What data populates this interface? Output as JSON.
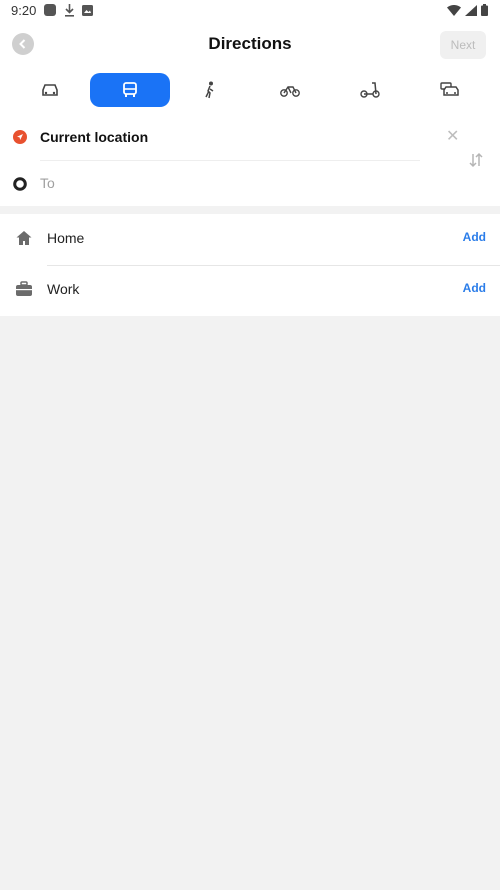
{
  "status_bar": {
    "time": "9:20"
  },
  "header": {
    "title": "Directions",
    "next_label": "Next"
  },
  "transport_modes": [
    "car",
    "transit",
    "walk",
    "bike",
    "scooter",
    "taxi"
  ],
  "active_mode": "transit",
  "route": {
    "from_value": "Current location",
    "to_placeholder": "To"
  },
  "places": [
    {
      "label": "Home",
      "action": "Add"
    },
    {
      "label": "Work",
      "action": "Add"
    }
  ],
  "colors": {
    "accent": "#1a73f6",
    "origin_marker": "#e8512f",
    "add_link": "#2b7de9"
  }
}
